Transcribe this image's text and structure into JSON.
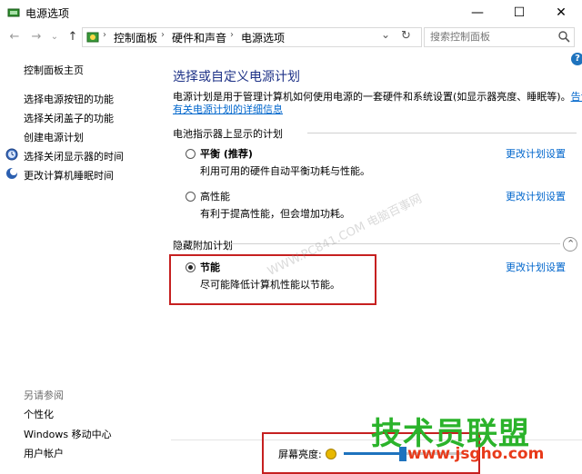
{
  "window": {
    "title": "电源选项",
    "minimize_glyph": "—",
    "maximize_glyph": "☐",
    "close_glyph": "✕"
  },
  "nav": {
    "back_glyph": "←",
    "forward_glyph": "→",
    "history_glyph": "⌄",
    "up_glyph": "↑",
    "breadcrumbs": [
      "控制面板",
      "硬件和声音",
      "电源选项"
    ],
    "crumb_sep": "›",
    "dropdown_glyph": "⌄",
    "refresh_glyph": "↻",
    "search_placeholder": "搜索控制面板"
  },
  "help": {
    "glyph": "?"
  },
  "sidebar": {
    "home": "控制面板主页",
    "items": [
      "选择电源按钮的功能",
      "选择关闭盖子的功能",
      "创建电源计划",
      "选择关闭显示器的时间",
      "更改计算机睡眠时间"
    ],
    "see_also": "另请参阅",
    "see_also_items": [
      "个性化",
      "Windows 移动中心",
      "用户帐户"
    ]
  },
  "main": {
    "heading": "选择或自定义电源计划",
    "desc_line1": "电源计划是用于管理计算机如何使用电源的一套硬件和系统设置(如显示器亮度、睡眠等)。",
    "desc_link_part1": "告诉我",
    "desc_link_part2": "有关电源计划的详细信息",
    "battery_group": "电池指示器上显示的计划",
    "plans": [
      {
        "name": "平衡 (推荐)",
        "desc": "利用可用的硬件自动平衡功耗与性能。",
        "change": "更改计划设置"
      },
      {
        "name": "高性能",
        "desc": "有利于提高性能，但会增加功耗。",
        "change": "更改计划设置"
      }
    ],
    "hidden_group": "隐藏附加计划",
    "hidden_plan": {
      "name": "节能",
      "desc": "尽可能降低计算机性能以节能。",
      "change": "更改计划设置"
    },
    "collapse_glyph": "⌃"
  },
  "bottom": {
    "brightness_label": "屏幕亮度:",
    "brightness_level": 0.5
  },
  "watermark": "WWW.PC841.COM 电脑百事网",
  "logo": {
    "text": "技术员联盟",
    "url": "www.jsgho.com"
  },
  "colors": {
    "accent": "#1e73be",
    "link": "#0066cc",
    "heading": "#1e3287",
    "highlight_box": "#c62020",
    "logo_green": "#2bb32b",
    "logo_red": "#e83a1a"
  }
}
